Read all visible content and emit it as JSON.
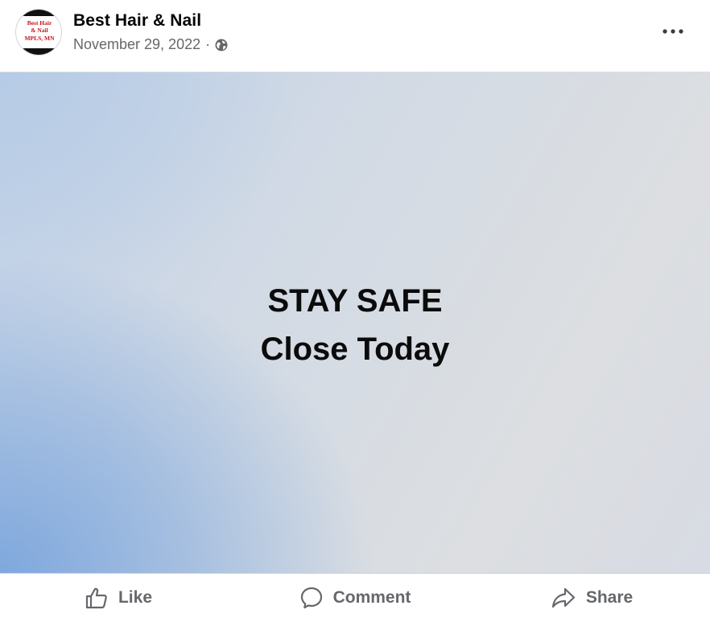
{
  "post": {
    "page_name": "Best Hair & Nail",
    "date": "November 29, 2022",
    "separator": "·",
    "avatar_text": {
      "line1": "Best Hair",
      "line2": "& Nail",
      "line3": "MPLS, MN"
    }
  },
  "image": {
    "line1": "STAY SAFE",
    "line2": "Close Today"
  },
  "actions": {
    "like": "Like",
    "comment": "Comment",
    "share": "Share"
  },
  "icons": {
    "audience": "globe-icon",
    "menu": "more-options-icon",
    "like": "thumbs-up-icon",
    "comment": "speech-bubble-icon",
    "share": "share-arrow-icon"
  },
  "colors": {
    "text_primary": "#050505",
    "text_secondary": "#65676b",
    "logo_red": "#c4161c"
  }
}
